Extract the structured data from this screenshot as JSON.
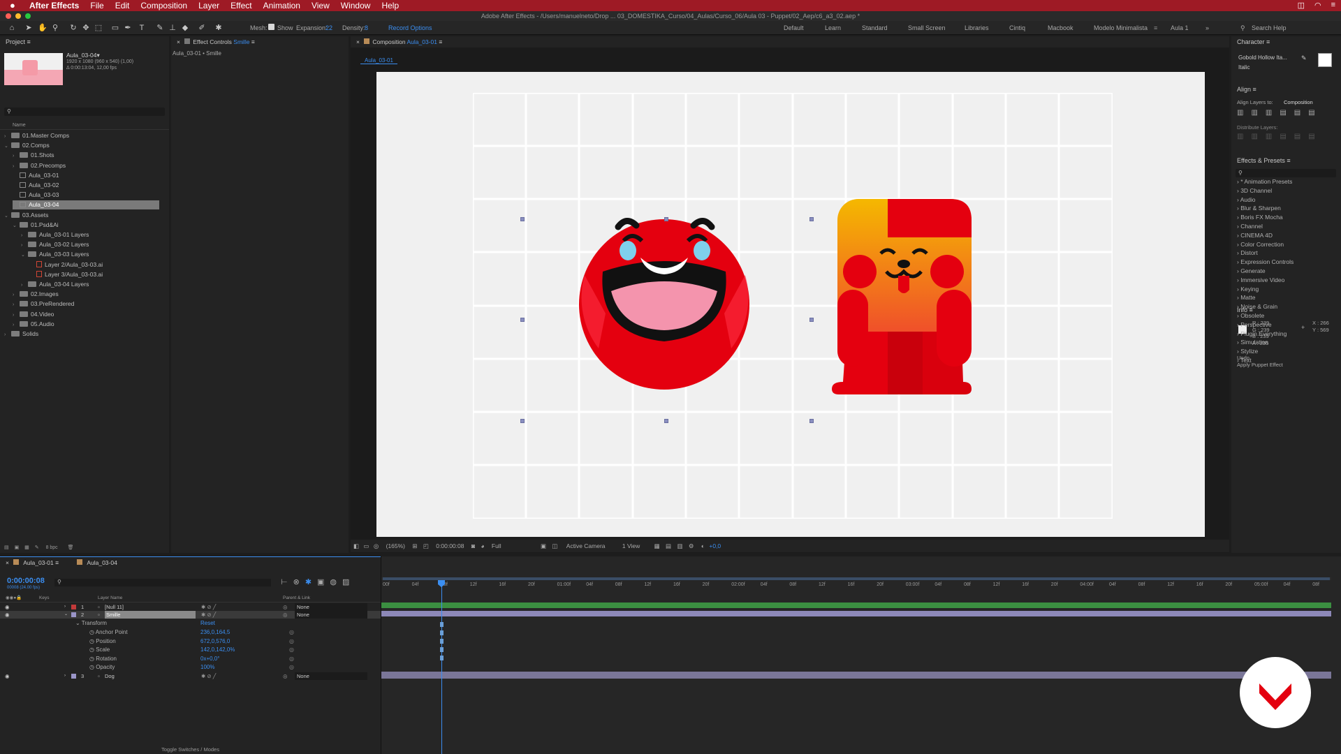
{
  "menubar": {
    "app_name": "After Effects",
    "items": [
      "File",
      "Edit",
      "Composition",
      "Layer",
      "Effect",
      "Animation",
      "View",
      "Window",
      "Help"
    ]
  },
  "titlebar": {
    "title": "Adobe After Effects - /Users/manuelneto/Drop ... 03_DOMESTIKA_Curso/04_Aulas/Curso_06/Aula 03 - Puppet/02_Aep/c6_a3_02.aep *"
  },
  "toolbar": {
    "mesh_label": "Mesh:",
    "show_label": "Show",
    "expansion_label": "Expansion:",
    "expansion_value": "22",
    "density_label": "Density:",
    "density_value": "8",
    "record_options": "Record Options",
    "workspaces": [
      "Default",
      "Learn",
      "Standard",
      "Small Screen",
      "Libraries",
      "Cintiq",
      "Macbook",
      "Modelo Minimalista",
      "Aula 1"
    ],
    "active_workspace": "Modelo Minimalista",
    "search_help": "Search Help"
  },
  "project": {
    "tab": "Project",
    "item_name": "Aula_03-04▾",
    "item_info1": "1920 x 1080  (960 x 540) (1,00)",
    "item_info2": "Δ 0:00:13:04, 12,00 fps",
    "column_name": "Name",
    "bpc": "8 bpc",
    "tree": [
      {
        "label": "01.Master Comps",
        "indent": 0,
        "type": "folder",
        "arrow": "›"
      },
      {
        "label": "02.Comps",
        "indent": 0,
        "type": "folder",
        "arrow": "⌄"
      },
      {
        "label": "01.Shots",
        "indent": 1,
        "type": "folder",
        "arrow": "›"
      },
      {
        "label": "02.Precomps",
        "indent": 1,
        "type": "folder",
        "arrow": "›"
      },
      {
        "label": "Aula_03-01",
        "indent": 1,
        "type": "comp",
        "arrow": ""
      },
      {
        "label": "Aula_03-02",
        "indent": 1,
        "type": "comp",
        "arrow": ""
      },
      {
        "label": "Aula_03-03",
        "indent": 1,
        "type": "comp",
        "arrow": ""
      },
      {
        "label": "Aula_03-04",
        "indent": 1,
        "type": "comp",
        "arrow": "",
        "selected": true
      },
      {
        "label": "03.Assets",
        "indent": 0,
        "type": "folder",
        "arrow": "⌄"
      },
      {
        "label": "01.Psd&Ai",
        "indent": 1,
        "type": "folder",
        "arrow": "⌄"
      },
      {
        "label": "Aula_03-01 Layers",
        "indent": 2,
        "type": "folder",
        "arrow": "›"
      },
      {
        "label": "Aula_03-02 Layers",
        "indent": 2,
        "type": "folder",
        "arrow": "›"
      },
      {
        "label": "Aula_03-03 Layers",
        "indent": 2,
        "type": "folder",
        "arrow": "⌄"
      },
      {
        "label": "Layer 2/Aula_03-03.ai",
        "indent": 3,
        "type": "ai",
        "arrow": ""
      },
      {
        "label": "Layer 3/Aula_03-03.ai",
        "indent": 3,
        "type": "ai",
        "arrow": ""
      },
      {
        "label": "Aula_03-04 Layers",
        "indent": 2,
        "type": "folder",
        "arrow": "›"
      },
      {
        "label": "02.Images",
        "indent": 1,
        "type": "folder",
        "arrow": "›"
      },
      {
        "label": "03.PreRendered",
        "indent": 1,
        "type": "folder",
        "arrow": "›"
      },
      {
        "label": "04.Video",
        "indent": 1,
        "type": "folder",
        "arrow": "›"
      },
      {
        "label": "05.Audio",
        "indent": 1,
        "type": "folder",
        "arrow": "›"
      },
      {
        "label": "Solids",
        "indent": 0,
        "type": "folder",
        "arrow": "›"
      }
    ]
  },
  "effect_controls": {
    "tab_prefix": "Effect Controls",
    "tab_layer": "Smille",
    "subtitle": "Aula_03-01 • Smille"
  },
  "composition": {
    "tab_prefix": "Composition",
    "tab_comp": "Aula_03-01",
    "breadcrumb": "Aula_03-01",
    "zoom": "(165%)",
    "timecode": "0:00:00:08",
    "resolution": "Full",
    "camera": "Active Camera",
    "view": "1 View",
    "exposure": "+0,0"
  },
  "character": {
    "title": "Character",
    "font": "Gobold Hollow Ita...",
    "style": "Italic"
  },
  "align": {
    "title": "Align",
    "align_to_label": "Align Layers to:",
    "align_to_value": "Composition",
    "distribute_label": "Distribute Layers:"
  },
  "effects_presets": {
    "title": "Effects & Presets",
    "items": [
      "* Animation Presets",
      "3D Channel",
      "Audio",
      "Blur & Sharpen",
      "Boris FX Mocha",
      "Channel",
      "CINEMA 4D",
      "Color Correction",
      "Distort",
      "Expression Controls",
      "Generate",
      "Immersive Video",
      "Keying",
      "Matte",
      "Noise & Grain",
      "Obsolete",
      "Perspective",
      "Plugin Everything",
      "Simulation",
      "Stylize",
      "Text"
    ]
  },
  "info": {
    "title": "Info",
    "r": "R : 239",
    "g": "G : 239",
    "b": "B : 239",
    "a": "A : 255",
    "x": "X : 266",
    "y": "Y : 569",
    "undo": "Undo",
    "undo_action": "Apply Puppet Effect"
  },
  "timeline": {
    "tabs": [
      "Aula_03-01",
      "Aula_03-04"
    ],
    "timecode": "0:00:00:08",
    "frame_info": "00008 (24.00 fps)",
    "col_layer_name": "Layer Name",
    "col_parent": "Parent & Link",
    "col_keys": "Keys",
    "toggle_label": "Toggle Switches / Modes",
    "ruler": [
      "00f",
      "04f",
      "08f",
      "12f",
      "16f",
      "20f",
      "01:00f",
      "04f",
      "08f",
      "12f",
      "16f",
      "20f",
      "02:00f",
      "04f",
      "08f",
      "12f",
      "16f",
      "20f",
      "03:00f",
      "04f",
      "08f",
      "12f",
      "16f",
      "20f",
      "04:00f",
      "04f",
      "08f",
      "12f",
      "16f",
      "20f",
      "05:00f",
      "04f",
      "08f"
    ],
    "layers": [
      {
        "num": "1",
        "name": "[Null 11]",
        "color": "#c23a3a",
        "parent": "None"
      },
      {
        "num": "2",
        "name": "Smille",
        "color": "#9a95c8",
        "parent": "None"
      },
      {
        "num": "3",
        "name": "Dog",
        "color": "#9a95c8",
        "parent": "None"
      }
    ],
    "transform": {
      "label": "Transform",
      "reset": "Reset",
      "props": [
        {
          "name": "Anchor Point",
          "value": "236,0,164,5"
        },
        {
          "name": "Position",
          "value": "672,0,576,0"
        },
        {
          "name": "Scale",
          "value": "142,0,142,0%"
        },
        {
          "name": "Rotation",
          "value": "0x+0,0°"
        },
        {
          "name": "Opacity",
          "value": "100%"
        }
      ]
    }
  },
  "colors": {
    "accent": "#3b8ef0",
    "menubar": "#9e1a25",
    "smiley": "#e4000f",
    "dog_top": "#f5b800",
    "layer_bar": "#8d88b8"
  }
}
